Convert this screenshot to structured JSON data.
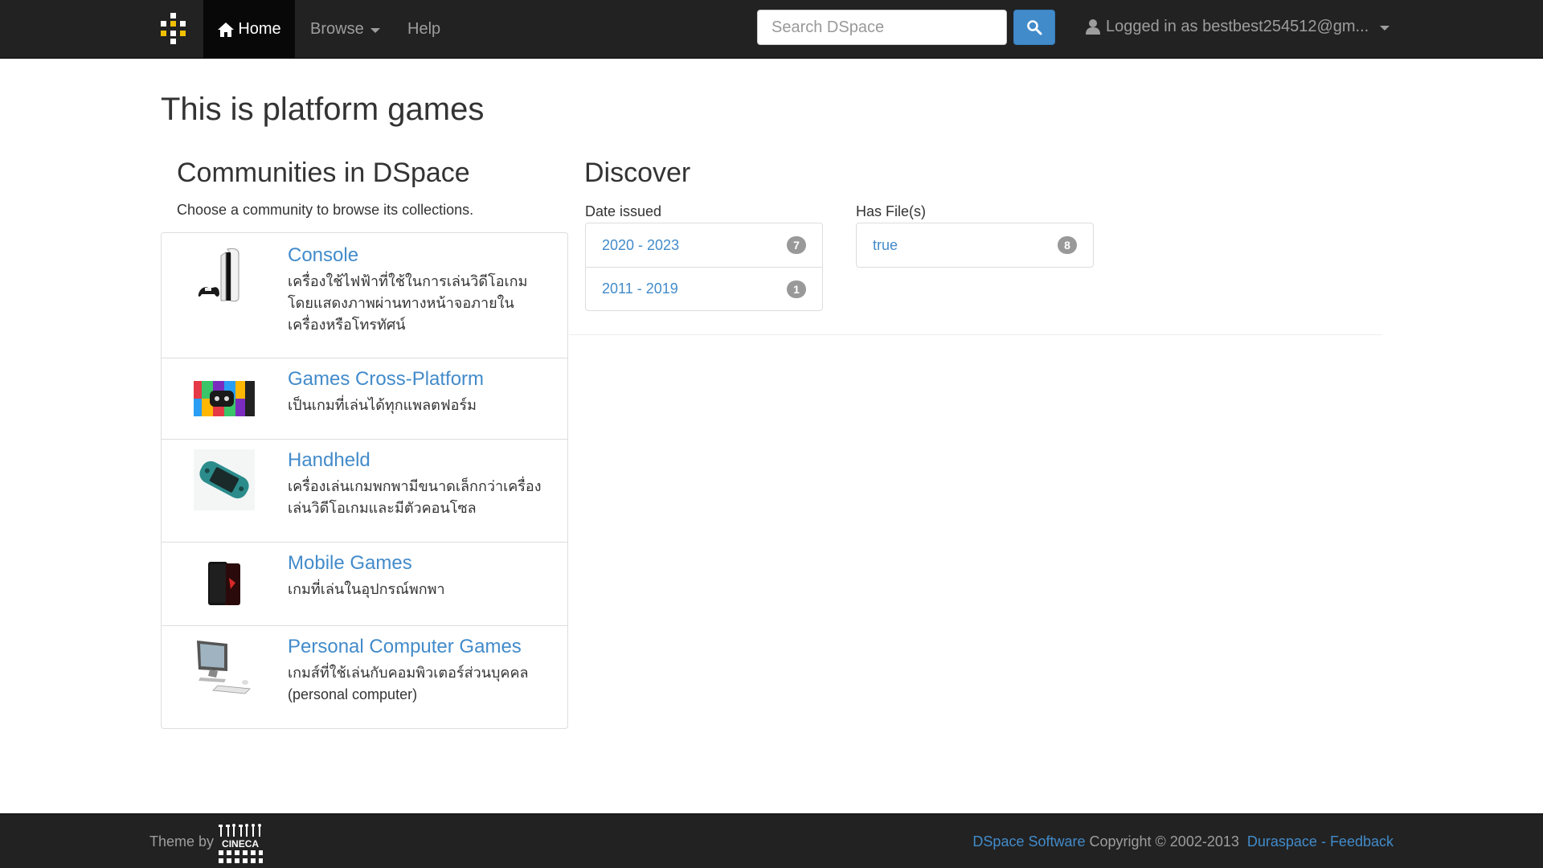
{
  "navbar": {
    "home_label": "Home",
    "browse_label": "Browse",
    "help_label": "Help",
    "search_placeholder": "Search DSpace",
    "user_label": "Logged in as bestbest254512@gm..."
  },
  "main": {
    "page_title": "This is platform games",
    "communities": {
      "title": "Communities in DSpace",
      "intro": "Choose a community to browse its collections.",
      "items": [
        {
          "name": "Console",
          "description": "เครื่องใช้ไฟฟ้าที่ใช้ในการเล่นวิดีโอเกม โดยแสดงภาพผ่านทางหน้าจอภายในเครื่องหรือโทรทัศน์",
          "thumb_icon": "console-icon"
        },
        {
          "name": "Games Cross-Platform",
          "description": "เป็นเกมที่เล่นได้ทุกแพลตฟอร์ม",
          "thumb_icon": "cross-platform-icon"
        },
        {
          "name": "Handheld",
          "description": "เครื่องเล่นเกมพกพามีขนาดเล็กกว่าเครื่องเล่นวิดีโอเกมและมีตัวคอนโซล",
          "thumb_icon": "handheld-icon"
        },
        {
          "name": "Mobile Games",
          "description": "เกมที่เล่นในอุปกรณ์พกพา",
          "thumb_icon": "mobile-icon"
        },
        {
          "name": "Personal Computer Games",
          "description": "เกมส์ที่ใช้เล่นกับคอมพิวเตอร์ส่วนบุคคล (personal computer)",
          "thumb_icon": "computer-icon"
        }
      ]
    },
    "discover": {
      "title": "Discover",
      "date_issued": {
        "label": "Date issued",
        "items": [
          {
            "label": "2020 - 2023",
            "count": "7"
          },
          {
            "label": "2011 - 2019",
            "count": "1"
          }
        ]
      },
      "has_files": {
        "label": "Has File(s)",
        "items": [
          {
            "label": "true",
            "count": "8"
          }
        ]
      }
    }
  },
  "footer": {
    "theme_by": "Theme by",
    "theme_logo_text": "CINECA",
    "dspace_software": "DSpace Software",
    "copyright": "Copyright © 2002-2013",
    "duraspace": "Duraspace",
    "separator": "-",
    "feedback": "Feedback"
  },
  "colors": {
    "navbar_bg": "#222222",
    "link": "#428bca",
    "badge": "#999999"
  }
}
